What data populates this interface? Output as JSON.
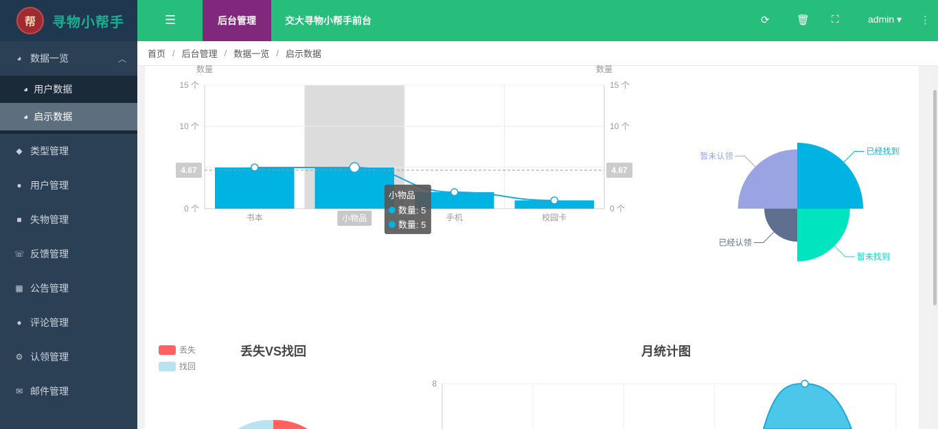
{
  "brand": {
    "title": "寻物小帮手",
    "badge": "帮"
  },
  "topbar": {
    "tab_admin": "后台管理",
    "tab_front": "交大寻物小帮手前台",
    "user": "admin ▾",
    "icons": [
      "refresh-icon",
      "trash-icon",
      "fullscreen-icon",
      "more-icon"
    ]
  },
  "sidebar": {
    "open_menu": "数据一览",
    "sub_items": [
      {
        "label": "用户数据",
        "active": false
      },
      {
        "label": "启示数据",
        "active": true
      }
    ],
    "items": [
      {
        "label": "类型管理",
        "icon": "tag-icon"
      },
      {
        "label": "用户管理",
        "icon": "user-icon"
      },
      {
        "label": "失物管理",
        "icon": "briefcase-icon"
      },
      {
        "label": "反馈管理",
        "icon": "phone-icon"
      },
      {
        "label": "公告管理",
        "icon": "calendar-icon"
      },
      {
        "label": "评论管理",
        "icon": "comment-icon"
      },
      {
        "label": "认领管理",
        "icon": "cogs-icon"
      },
      {
        "label": "邮件管理",
        "icon": "mail-icon"
      }
    ]
  },
  "breadcrumb": [
    "首页",
    "后台管理",
    "数据一览",
    "启示数据"
  ],
  "chart_data": [
    {
      "type": "bar",
      "categories": [
        "书本",
        "小物品",
        "手机",
        "校园卡"
      ],
      "series": [
        {
          "name": "数量",
          "type": "bar",
          "values": [
            5,
            5,
            2,
            1
          ]
        },
        {
          "name": "数量",
          "type": "line",
          "values": [
            5,
            5,
            2,
            1
          ]
        }
      ],
      "ylabel_left": "数量",
      "ylabel_right": "数量",
      "ylim": [
        0,
        15
      ],
      "yticks": [
        "0 个",
        "5 个",
        "10 个",
        "15 个"
      ],
      "mean_line": 4.67,
      "mean_label": "4.67",
      "highlight_category": "小物品",
      "tooltip": {
        "title": "小物品",
        "lines": [
          "数量: 5",
          "数量: 5"
        ]
      },
      "color": "#00b3e3"
    },
    {
      "type": "pie",
      "rose": true,
      "slices": [
        {
          "name": "已经找到",
          "value": 10,
          "color": "#00b3e3"
        },
        {
          "name": "暂未找到",
          "value": 8,
          "color": "#00e5c0"
        },
        {
          "name": "已经认领",
          "value": 5,
          "color": "#5f6f8f"
        },
        {
          "name": "暂未认领",
          "value": 9,
          "color": "#9ba4e2"
        }
      ]
    },
    {
      "type": "pie",
      "title": "丢失VS找回",
      "legend": [
        {
          "name": "丢失",
          "color": "#ff6161"
        },
        {
          "name": "找回",
          "color": "#b9e3ee"
        }
      ]
    },
    {
      "type": "area",
      "title": "月统计图",
      "yticks": [
        "8"
      ],
      "ylim": [
        0,
        8
      ],
      "peak": 8,
      "color": "#4cc7ea"
    }
  ]
}
